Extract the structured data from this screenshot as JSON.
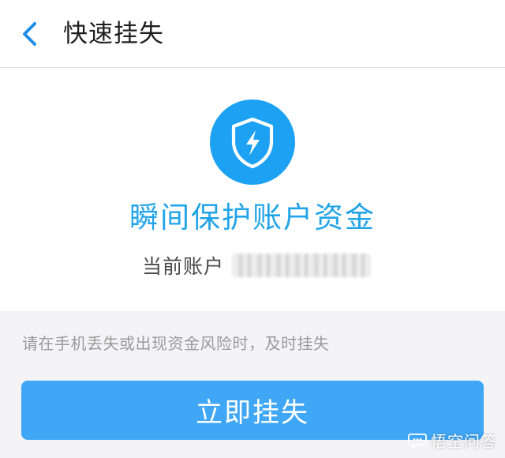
{
  "header": {
    "title": "快速挂失",
    "back_icon": "chevron-left-icon"
  },
  "panel": {
    "badge_icon": "shield-lightning-icon",
    "title": "瞬间保护账户资金",
    "account_label": "当前账户"
  },
  "hint": "请在手机丢失或出现资金风险时，及时挂失",
  "action": {
    "label": "立即挂失"
  },
  "watermark": {
    "text": "悟空问答"
  },
  "colors": {
    "accent": "#1da1f2",
    "title_blue": "#21a4e8",
    "button_blue": "#3fa7f5",
    "background": "#f4f4f6"
  }
}
